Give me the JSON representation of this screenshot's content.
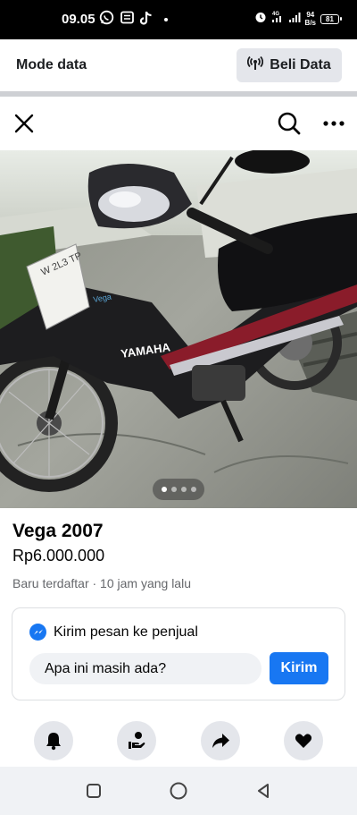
{
  "status_bar": {
    "time": "09.05",
    "network_speed_value": "94",
    "network_speed_unit": "B/s",
    "battery_level": "81",
    "icons": [
      "whatsapp-icon",
      "message-icon",
      "tiktok-icon",
      "alarm-icon",
      "signal-4g-icon",
      "signal-icon",
      "battery-icon"
    ]
  },
  "data_bar": {
    "title": "Mode data",
    "beli_label": "Beli Data",
    "beli_icon": "broadcast-icon"
  },
  "header": {
    "icons": [
      "close-icon",
      "search-icon",
      "more-icon"
    ]
  },
  "photo": {
    "total_images": 4,
    "active_index": 1,
    "brand_text": "YAMAHA"
  },
  "listing": {
    "title": "Vega 2007",
    "price": "Rp6.000.000",
    "meta": "Baru terdaftar · 10 jam yang lalu"
  },
  "message_card": {
    "heading": "Kirim pesan ke penjual",
    "input_value": "Apa ini masih ada?",
    "send_label": "Kirim"
  },
  "actions": [
    "bell-icon",
    "hand-heart-icon",
    "share-icon",
    "heart-icon"
  ],
  "navigation": [
    "recent-apps-icon",
    "home-icon",
    "back-icon"
  ],
  "colors": {
    "accent": "#1877f2",
    "button_grey": "#e4e6eb",
    "secondary_text": "#65676b"
  }
}
